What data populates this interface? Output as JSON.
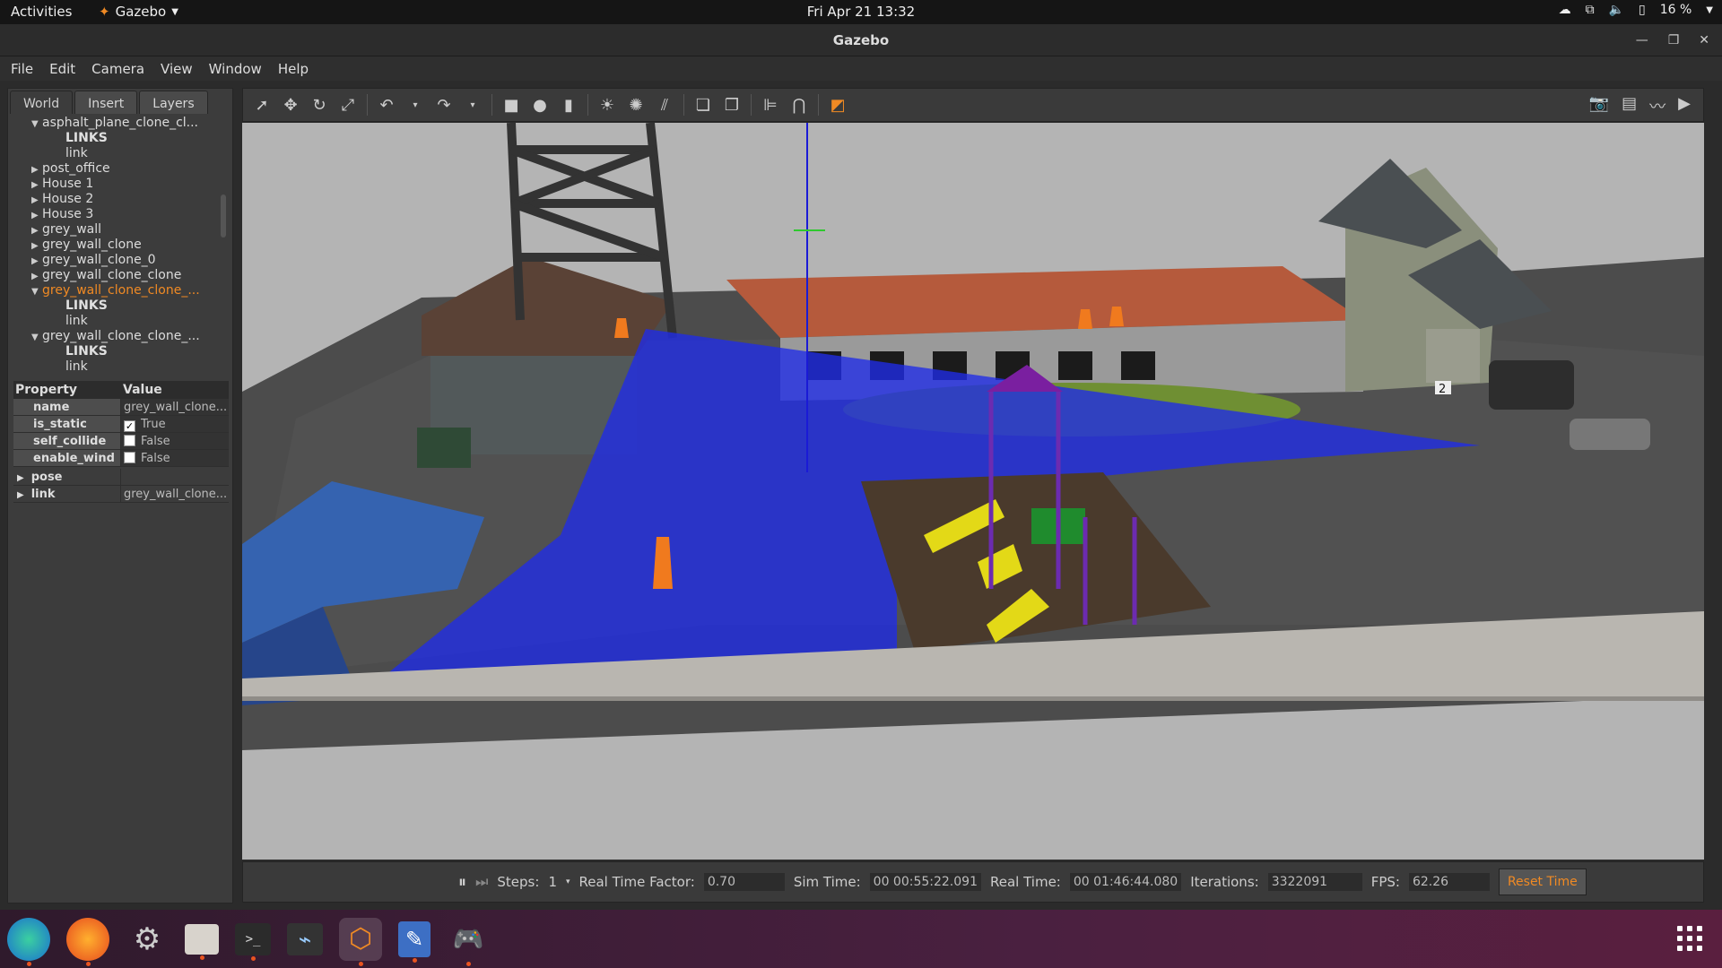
{
  "topbar": {
    "activities": "Activities",
    "app_name": "Gazebo",
    "clock": "Fri Apr 21  13:32",
    "battery": "16 %"
  },
  "window": {
    "title": "Gazebo"
  },
  "menu": [
    "File",
    "Edit",
    "Camera",
    "View",
    "Window",
    "Help"
  ],
  "left_panel": {
    "tabs": [
      "World",
      "Insert",
      "Layers"
    ],
    "tree": [
      {
        "label": "asphalt_plane_clone_cl...",
        "arrow": "down",
        "indent": 1,
        "type": "model"
      },
      {
        "label": "LINKS",
        "indent": 2,
        "type": "section"
      },
      {
        "label": "link",
        "indent": 2,
        "type": "leaf"
      },
      {
        "label": "post_office",
        "arrow": "right",
        "indent": 1,
        "type": "model"
      },
      {
        "label": "House 1",
        "arrow": "right",
        "indent": 1,
        "type": "model"
      },
      {
        "label": "House 2",
        "arrow": "right",
        "indent": 1,
        "type": "model"
      },
      {
        "label": "House 3",
        "arrow": "right",
        "indent": 1,
        "type": "model"
      },
      {
        "label": "grey_wall",
        "arrow": "right",
        "indent": 1,
        "type": "model"
      },
      {
        "label": "grey_wall_clone",
        "arrow": "right",
        "indent": 1,
        "type": "model"
      },
      {
        "label": "grey_wall_clone_0",
        "arrow": "right",
        "indent": 1,
        "type": "model"
      },
      {
        "label": "grey_wall_clone_clone",
        "arrow": "right",
        "indent": 1,
        "type": "model"
      },
      {
        "label": "grey_wall_clone_clone_...",
        "arrow": "down",
        "indent": 1,
        "type": "model",
        "selected": true
      },
      {
        "label": "LINKS",
        "indent": 2,
        "type": "section"
      },
      {
        "label": "link",
        "indent": 2,
        "type": "leaf"
      },
      {
        "label": "grey_wall_clone_clone_...",
        "arrow": "down",
        "indent": 1,
        "type": "model"
      },
      {
        "label": "LINKS",
        "indent": 2,
        "type": "section"
      },
      {
        "label": "link",
        "indent": 2,
        "type": "leaf"
      }
    ],
    "properties": {
      "header_property": "Property",
      "header_value": "Value",
      "rows": [
        {
          "key": "name",
          "value": "grey_wall_clone..."
        },
        {
          "key": "is_static",
          "value": "True",
          "checkbox": true,
          "checked": true
        },
        {
          "key": "self_collide",
          "value": "False",
          "checkbox": true,
          "checked": false
        },
        {
          "key": "enable_wind",
          "value": "False",
          "checkbox": true,
          "checked": false
        }
      ],
      "groups": [
        {
          "key": "pose",
          "value": ""
        },
        {
          "key": "link",
          "value": "grey_wall_clone..."
        }
      ]
    }
  },
  "status": {
    "steps_label": "Steps:",
    "steps_value": "1",
    "rtf_label": "Real Time Factor:",
    "rtf_value": "0.70",
    "sim_time_label": "Sim Time:",
    "sim_time_value": "00 00:55:22.091",
    "real_time_label": "Real Time:",
    "real_time_value": "00 01:46:44.080",
    "iterations_label": "Iterations:",
    "iterations_value": "3322091",
    "fps_label": "FPS:",
    "fps_value": "62.26",
    "reset_label": "Reset Time"
  },
  "viewport_labels": {
    "car_number": "2"
  },
  "colors": {
    "accent": "#f08a24",
    "laser": "#1f2be8",
    "ground": "#4e4e4e",
    "wall": "#b9b6b0"
  }
}
